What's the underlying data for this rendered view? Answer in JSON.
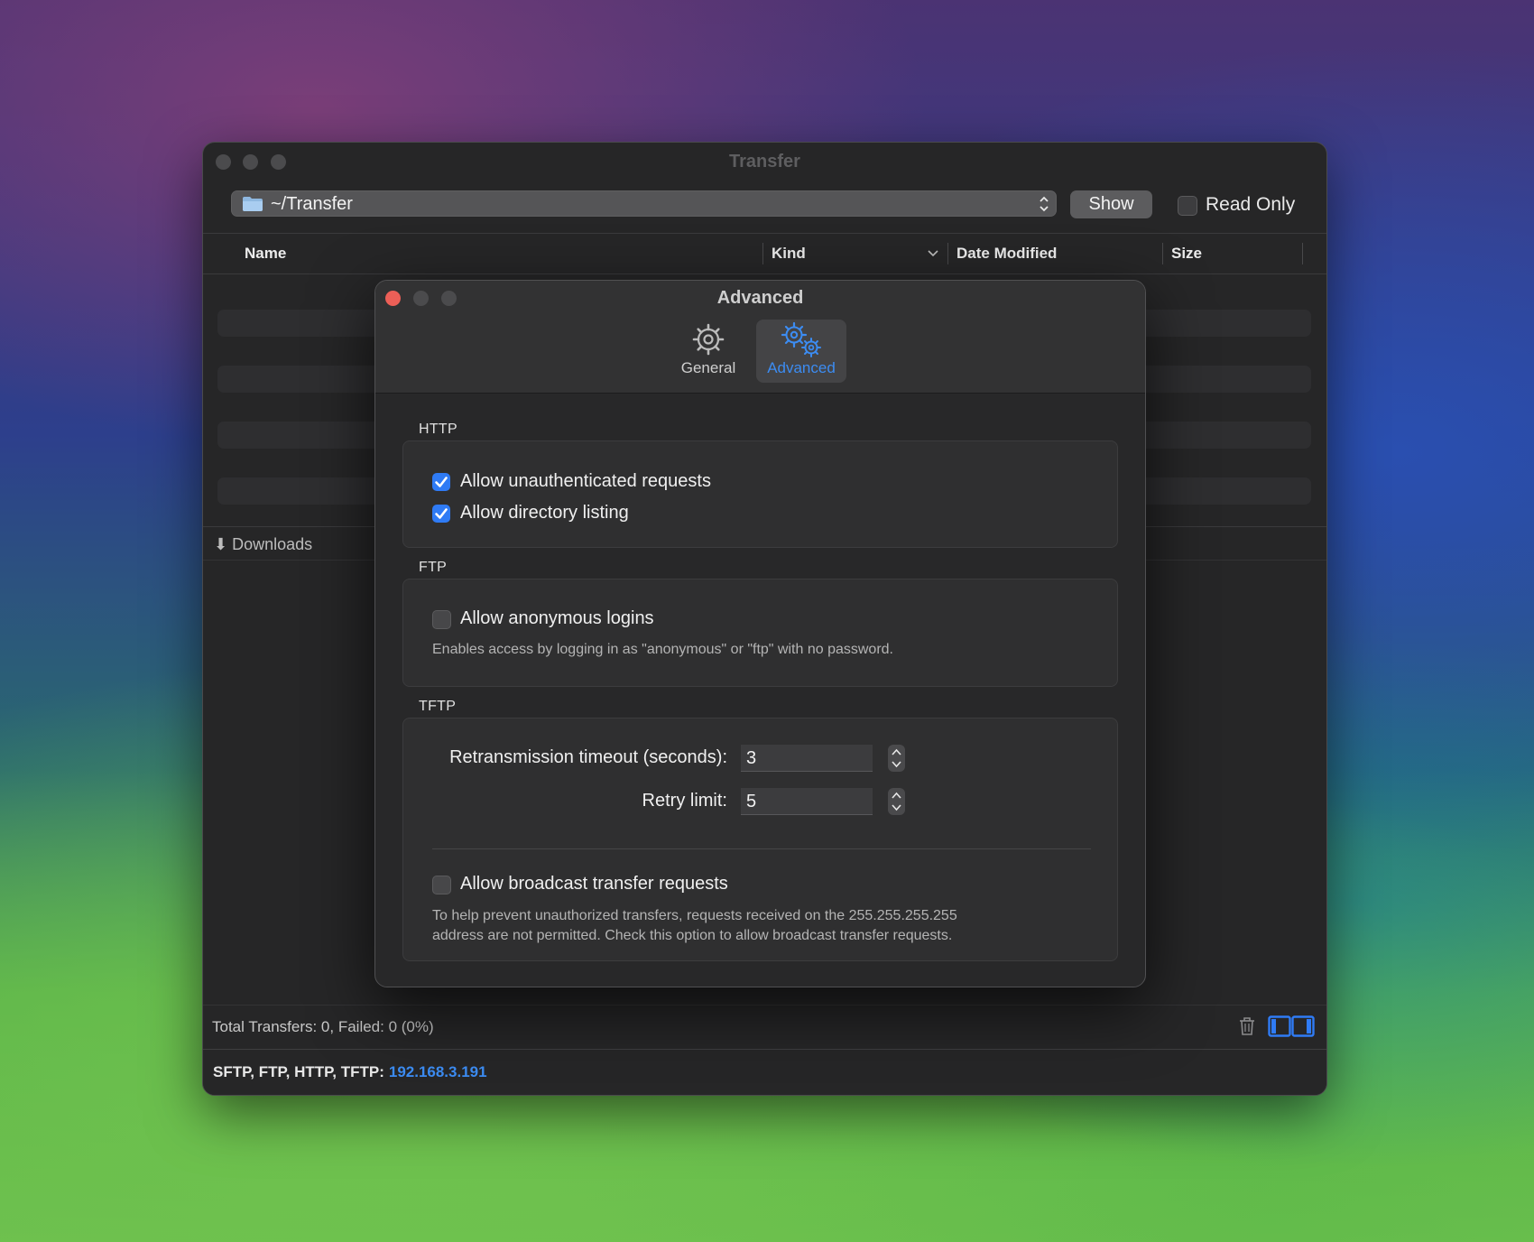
{
  "window": {
    "title": "Transfer",
    "path": "~/Transfer",
    "show_label": "Show",
    "read_only_label": "Read Only",
    "columns": [
      "Name",
      "Kind",
      "Date Modified",
      "Size"
    ],
    "downloads_label": "Downloads",
    "totals": "Total Transfers: 0, Failed: 0 (0%)",
    "protocols_label": "SFTP, FTP, HTTP, TFTP:",
    "ip_address": "192.168.3.191"
  },
  "dialog": {
    "title": "Advanced",
    "tabs": [
      {
        "label": "General",
        "icon": "gear-icon",
        "selected": false
      },
      {
        "label": "Advanced",
        "icon": "gears-icon",
        "selected": true
      }
    ],
    "http": {
      "label": "HTTP",
      "options": [
        {
          "label": "Allow unauthenticated requests",
          "checked": true
        },
        {
          "label": "Allow directory listing",
          "checked": true
        }
      ]
    },
    "ftp": {
      "label": "FTP",
      "anonymous_label": "Allow anonymous logins",
      "anonymous_checked": false,
      "anonymous_hint": "Enables access by logging in as \"anonymous\" or \"ftp\" with no password."
    },
    "tftp": {
      "label": "TFTP",
      "timeout_label": "Retransmission timeout (seconds):",
      "timeout_value": "3",
      "retry_label": "Retry limit:",
      "retry_value": "5",
      "broadcast_label": "Allow broadcast transfer requests",
      "broadcast_checked": false,
      "broadcast_hint_1": "To help prevent unauthorized transfers, requests received on the 255.255.255.255",
      "broadcast_hint_2": "address are not permitted. Check this option to allow broadcast transfer requests."
    }
  },
  "colors": {
    "accent": "#2f7bf5",
    "link": "#3c8cf2",
    "close_button": "#ec5f57"
  }
}
